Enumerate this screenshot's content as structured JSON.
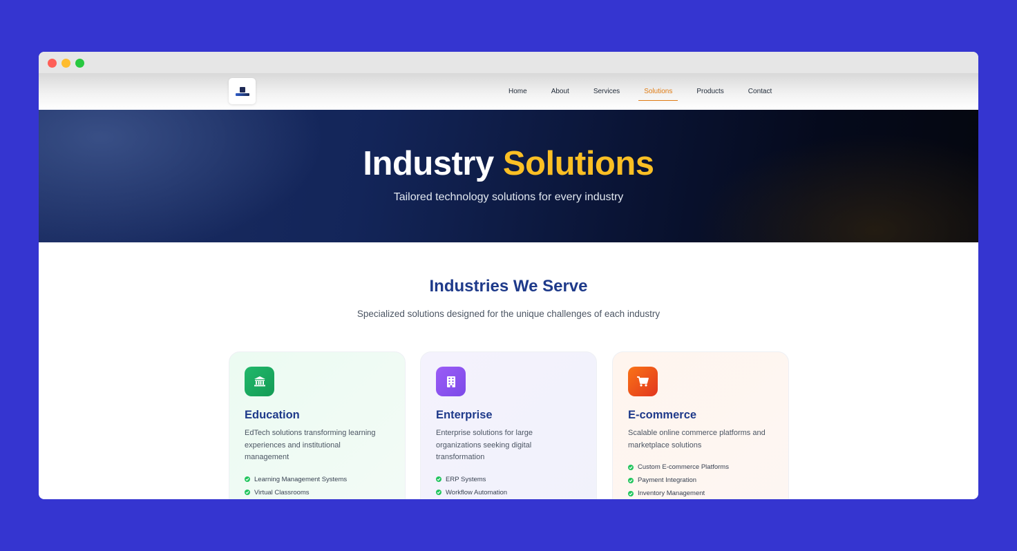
{
  "nav": {
    "links": [
      {
        "label": "Home"
      },
      {
        "label": "About"
      },
      {
        "label": "Services"
      },
      {
        "label": "Solutions",
        "active": true
      },
      {
        "label": "Products"
      },
      {
        "label": "Contact"
      }
    ]
  },
  "hero": {
    "title_main": "Industry",
    "title_accent": "Solutions",
    "subtitle": "Tailored technology solutions for every industry"
  },
  "section": {
    "title": "Industries We Serve",
    "subtitle": "Specialized solutions designed for the unique challenges of each industry"
  },
  "cards": [
    {
      "icon": "bank-icon",
      "title": "Education",
      "description": "EdTech solutions transforming learning experiences and institutional management",
      "features": [
        "Learning Management Systems",
        "Virtual Classrooms"
      ]
    },
    {
      "icon": "building-icon",
      "title": "Enterprise",
      "description": "Enterprise solutions for large organizations seeking digital transformation",
      "features": [
        "ERP Systems",
        "Workflow Automation"
      ]
    },
    {
      "icon": "cart-icon",
      "title": "E-commerce",
      "description": "Scalable online commerce platforms and marketplace solutions",
      "features": [
        "Custom E-commerce Platforms",
        "Payment Integration",
        "Inventory Management"
      ]
    }
  ],
  "colors": {
    "background": "#3535d0",
    "accent": "#fbbf24",
    "nav_active": "#e07b12",
    "heading": "#1e3a8a"
  }
}
